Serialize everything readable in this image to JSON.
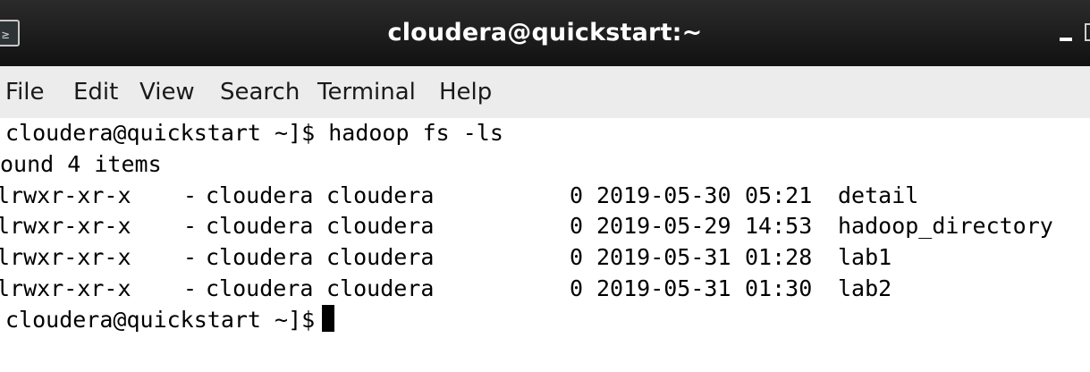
{
  "window": {
    "title": "cloudera@quickstart:~",
    "icon": "terminal-icon",
    "icon_glyph": "≥"
  },
  "menu": [
    "File",
    "Edit",
    "View",
    "Search",
    "Terminal",
    "Help"
  ],
  "terminal": {
    "command_line": "cloudera@quickstart ~]$ hadoop fs -ls",
    "summary_line": "ound 4 items",
    "rows": [
      {
        "perms": "lrwxr-xr-x",
        "repl": "-",
        "owner": "cloudera",
        "group": "cloudera",
        "size": "0",
        "date": "2019-05-30",
        "time": "05:21",
        "name": "detail"
      },
      {
        "perms": "lrwxr-xr-x",
        "repl": "-",
        "owner": "cloudera",
        "group": "cloudera",
        "size": "0",
        "date": "2019-05-29",
        "time": "14:53",
        "name": "hadoop_directory"
      },
      {
        "perms": "lrwxr-xr-x",
        "repl": "-",
        "owner": "cloudera",
        "group": "cloudera",
        "size": "0",
        "date": "2019-05-31",
        "time": "01:28",
        "name": "lab1"
      },
      {
        "perms": "lrwxr-xr-x",
        "repl": "-",
        "owner": "cloudera",
        "group": "cloudera",
        "size": "0",
        "date": "2019-05-31",
        "time": "01:30",
        "name": "lab2"
      }
    ],
    "prompt": "cloudera@quickstart ~]$"
  }
}
